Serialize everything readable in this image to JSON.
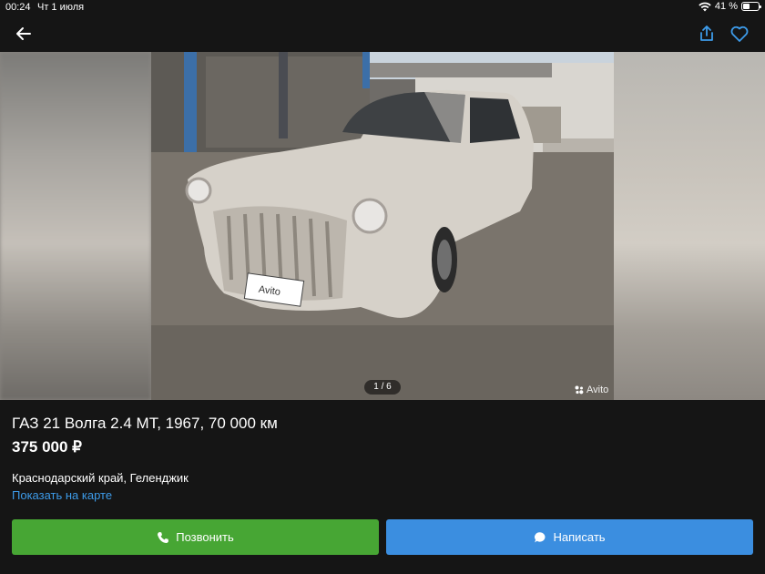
{
  "status_bar": {
    "time": "00:24",
    "date": "Чт 1 июля",
    "battery": "41 %",
    "battery_level": 0.41
  },
  "nav": {
    "back_icon": "arrow-left-icon",
    "share_icon": "share-icon",
    "favorite_icon": "heart-icon"
  },
  "gallery": {
    "counter": "1 / 6",
    "watermark": "Avito",
    "plate_text": "Avito"
  },
  "listing": {
    "title": "ГАЗ 21 Волга 2.4 MT, 1967, 70 000 км",
    "price": "375 000 ₽",
    "location": "Краснодарский край, Геленджик",
    "map_link": "Показать на карте"
  },
  "actions": {
    "call_label": "Позвонить",
    "write_label": "Написать"
  },
  "colors": {
    "background": "#151515",
    "call_button": "#47a634",
    "write_button": "#3b8ee0",
    "link": "#3d9be9"
  }
}
